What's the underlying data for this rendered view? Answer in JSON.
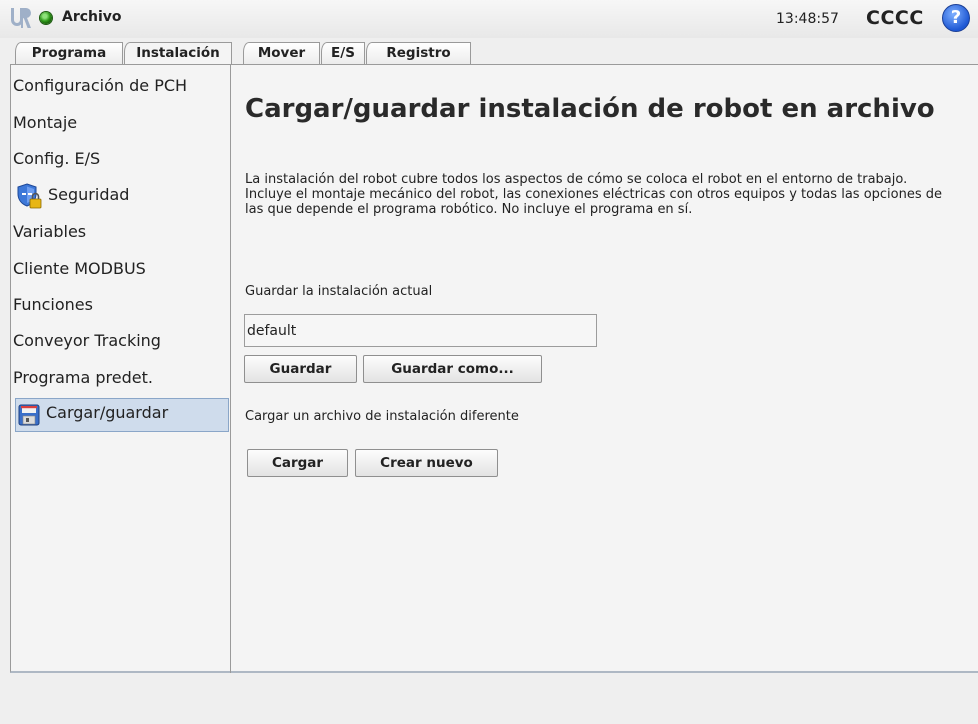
{
  "topbar": {
    "file_label": "Archivo",
    "clock": "13:48:57",
    "robot_name": "CCCC",
    "help_symbol": "?",
    "status_color": "#2f9a1a"
  },
  "tabs": [
    {
      "label": "Programa",
      "active": false
    },
    {
      "label": "Instalación",
      "active": true
    },
    {
      "label": "Mover",
      "active": false
    },
    {
      "label": "E/S",
      "active": false
    },
    {
      "label": "Registro",
      "active": false
    }
  ],
  "sidebar": {
    "items": [
      {
        "label": "Configuración de PCH"
      },
      {
        "label": "Montaje"
      },
      {
        "label": "Config. E/S"
      },
      {
        "label": "Seguridad",
        "icon": "shield-lock-icon"
      },
      {
        "label": "Variables"
      },
      {
        "label": "Cliente MODBUS"
      },
      {
        "label": "Funciones"
      },
      {
        "label": "Conveyor Tracking"
      },
      {
        "label": "Programa predet."
      },
      {
        "label": "Cargar/guardar",
        "icon": "floppy-disk-icon",
        "selected": true
      }
    ]
  },
  "main": {
    "title": "Cargar/guardar instalación de robot en archivo",
    "description": "La instalación del robot cubre todos los aspectos de cómo se coloca el robot en el entorno de trabajo. Incluye el montaje mecánico del robot, las conexiones eléctricas con otros equipos y todas las opciones de las que depende el programa robótico. No incluye el programa en sí.",
    "save_label": "Guardar la instalación actual",
    "installation_name": "default",
    "save_button": "Guardar",
    "save_as_button": "Guardar como...",
    "load_label": "Cargar un archivo de instalación diferente",
    "load_button": "Cargar",
    "new_button": "Crear nuevo"
  },
  "colors": {
    "selected_bg": "#cfdcec",
    "accent_blue": "#1e58d4"
  }
}
